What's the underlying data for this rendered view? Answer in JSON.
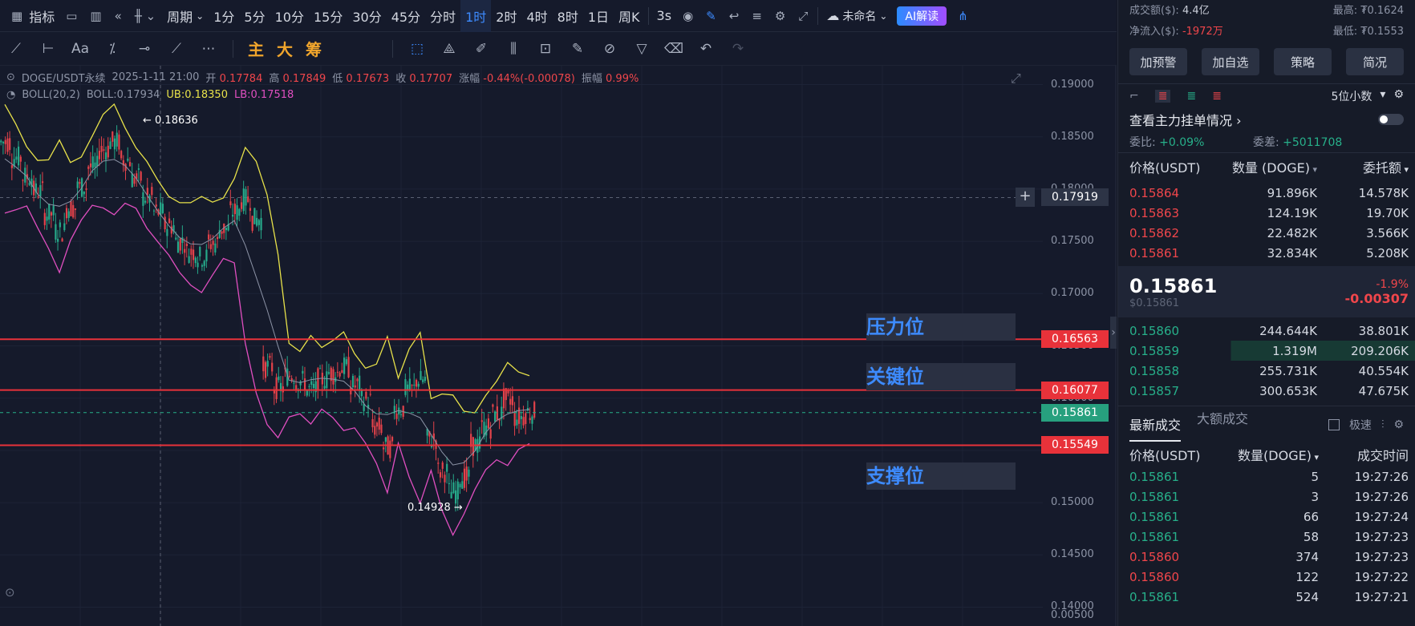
{
  "toolbar": {
    "indicator_label": "指标",
    "period_label": "周期",
    "intervals": [
      "1分",
      "5分",
      "10分",
      "15分",
      "30分",
      "45分",
      "分时",
      "1时",
      "2时",
      "4时",
      "8时",
      "1日",
      "周K"
    ],
    "active_interval": "1时",
    "speed_label": "3s",
    "layout_name": "未命名",
    "ai_label": "AI解读"
  },
  "drawbar": {
    "main": "主",
    "big": "大",
    "chips": "筹",
    "text_tool": "Aa"
  },
  "legend": {
    "symbol": "DOGE/USDT永续",
    "datetime": "2025-1-11 21:00",
    "open_label": "开",
    "open": "0.17784",
    "high_label": "高",
    "high": "0.17849",
    "low_label": "低",
    "low": "0.17673",
    "close_label": "收",
    "close": "0.17707",
    "change_label": "涨幅",
    "change": "-0.44%(-0.00078)",
    "amp_label": "振幅",
    "amp": "0.99%",
    "boll_name": "BOLL(20,2)",
    "boll": "BOLL:0.17934",
    "ub": "UB:0.18350",
    "lb": "LB:0.17518"
  },
  "chart_data": {
    "type": "candlestick",
    "y_axis_ticks": [
      "0.19000",
      "0.18500",
      "0.18000",
      "0.17500",
      "0.17000",
      "0.16500",
      "0.16000",
      "0.15500",
      "0.15000",
      "0.14500",
      "0.14000",
      "0.00500"
    ],
    "ylim": [
      0.1385,
      0.1915
    ],
    "crosshair_price": "0.17919",
    "high_annotation": "0.18636",
    "low_annotation": "0.14928",
    "current_price": "0.15861",
    "levels": [
      {
        "name": "压力位",
        "price": "0.16563",
        "value": 0.16563
      },
      {
        "name": "关键位",
        "price": "0.16077",
        "value": 0.16077
      },
      {
        "name": "支撑位",
        "price": "0.15549",
        "value": 0.15549
      }
    ],
    "close_series": [
      0.1845,
      0.183,
      0.1812,
      0.1798,
      0.1776,
      0.176,
      0.1782,
      0.1802,
      0.1821,
      0.1838,
      0.1845,
      0.1828,
      0.181,
      0.1792,
      0.1778,
      0.1765,
      0.175,
      0.174,
      0.1735,
      0.1748,
      0.1762,
      0.1778,
      0.179,
      0.1771,
      0.163,
      0.161,
      0.1622,
      0.1616,
      0.1608,
      0.1618,
      0.1624,
      0.1629,
      0.1612,
      0.1598,
      0.1572,
      0.1553,
      0.159,
      0.1608,
      0.1617,
      0.1561,
      0.153,
      0.151,
      0.1524,
      0.1555,
      0.1572,
      0.1585,
      0.1599,
      0.1582,
      0.1586
    ]
  },
  "right": {
    "turnover_label": "成交额($):",
    "turnover": "4.4亿",
    "high_label": "最高:",
    "high": "₮0.1624",
    "netflow_label": "净流入($):",
    "netflow": "-1972万",
    "low_label": "最低:",
    "low": "₮0.1553",
    "buttons": [
      "加预警",
      "加自选",
      "策略",
      "简况"
    ],
    "decimals": "5位小数",
    "main_orders": "查看主力挂单情况",
    "weibi_label": "委比:",
    "weibi": "+0.09%",
    "weicha_label": "委差:",
    "weicha": "+5011708",
    "ob_headers": {
      "price": "价格(USDT)",
      "qty": "数量 (DOGE)",
      "amount": "委托额"
    },
    "asks": [
      {
        "p": "0.15864",
        "q": "91.896K",
        "a": "14.578K"
      },
      {
        "p": "0.15863",
        "q": "124.19K",
        "a": "19.70K"
      },
      {
        "p": "0.15862",
        "q": "22.482K",
        "a": "3.566K"
      },
      {
        "p": "0.15861",
        "q": "32.834K",
        "a": "5.208K"
      }
    ],
    "last_price": "0.15861",
    "last_usd": "$0.15861",
    "change_pct": "-1.9%",
    "change_abs": "-0.00307",
    "bids": [
      {
        "p": "0.15860",
        "q": "244.644K",
        "a": "38.801K"
      },
      {
        "p": "0.15859",
        "q": "1.319M",
        "a": "209.206K"
      },
      {
        "p": "0.15858",
        "q": "255.731K",
        "a": "40.554K"
      },
      {
        "p": "0.15857",
        "q": "300.653K",
        "a": "47.675K"
      }
    ],
    "tabs": {
      "latest": "最新成交",
      "large": "大额成交",
      "fast": "极速"
    },
    "trade_headers": {
      "price": "价格(USDT)",
      "qty": "数量(DOGE)",
      "time": "成交时间"
    },
    "trades": [
      {
        "p": "0.15861",
        "q": "5",
        "t": "19:27:26",
        "side": "buy"
      },
      {
        "p": "0.15861",
        "q": "3",
        "t": "19:27:26",
        "side": "buy"
      },
      {
        "p": "0.15861",
        "q": "66",
        "t": "19:27:24",
        "side": "buy"
      },
      {
        "p": "0.15861",
        "q": "58",
        "t": "19:27:23",
        "side": "buy"
      },
      {
        "p": "0.15860",
        "q": "374",
        "t": "19:27:23",
        "side": "sell"
      },
      {
        "p": "0.15860",
        "q": "122",
        "t": "19:27:22",
        "side": "sell"
      },
      {
        "p": "0.15861",
        "q": "524",
        "t": "19:27:21",
        "side": "buy"
      }
    ]
  }
}
